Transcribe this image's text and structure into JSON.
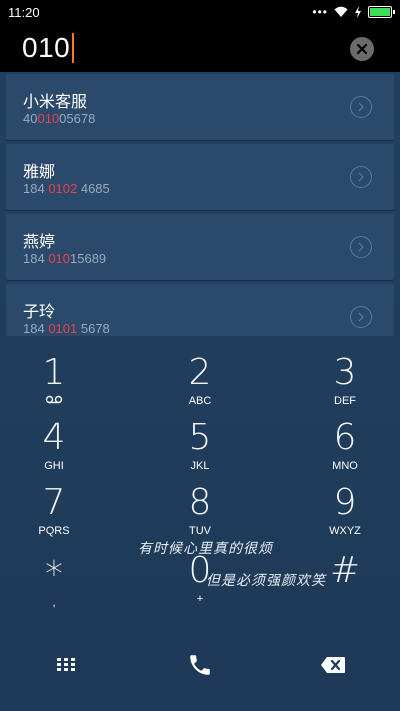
{
  "status_bar": {
    "time": "11:20",
    "dots": "•••",
    "battery_color": "#3ddc55"
  },
  "dialer": {
    "number": "010",
    "cursor_color": "#ff7a1f",
    "clear_icon": "clear-circle-x-icon"
  },
  "results": [
    {
      "name": "小米客服",
      "number_pre": "40",
      "number_hl": "010",
      "number_post": "05678"
    },
    {
      "name": "雅娜",
      "number_pre": "184 ",
      "number_hl": "0102",
      "number_post": " 4685"
    },
    {
      "name": "燕婷",
      "number_pre": "184 ",
      "number_hl": "010",
      "number_post": "15689"
    },
    {
      "name": "子玲",
      "number_pre": "184 ",
      "number_hl": "0101",
      "number_post": " 5678"
    }
  ],
  "highlight_color": "#e8424e",
  "keypad": [
    {
      "digit": "1",
      "letters": ""
    },
    {
      "digit": "2",
      "letters": "ABC"
    },
    {
      "digit": "3",
      "letters": "DEF"
    },
    {
      "digit": "4",
      "letters": "GHI"
    },
    {
      "digit": "5",
      "letters": "JKL"
    },
    {
      "digit": "6",
      "letters": "MNO"
    },
    {
      "digit": "7",
      "letters": "PQRS"
    },
    {
      "digit": "8",
      "letters": "TUV"
    },
    {
      "digit": "9",
      "letters": "WXYZ"
    },
    {
      "digit": "*",
      "letters": ","
    },
    {
      "digit": "0",
      "letters": "+"
    },
    {
      "digit": "#",
      "letters": ""
    }
  ],
  "overlay": {
    "line1": "有时候心里真的很烦",
    "line2": "但是必须强颜欢笑"
  },
  "bottom_bar": {
    "keypad_icon": "dialpad-grid-icon",
    "call_icon": "phone-call-icon",
    "backspace_icon": "backspace-icon"
  }
}
